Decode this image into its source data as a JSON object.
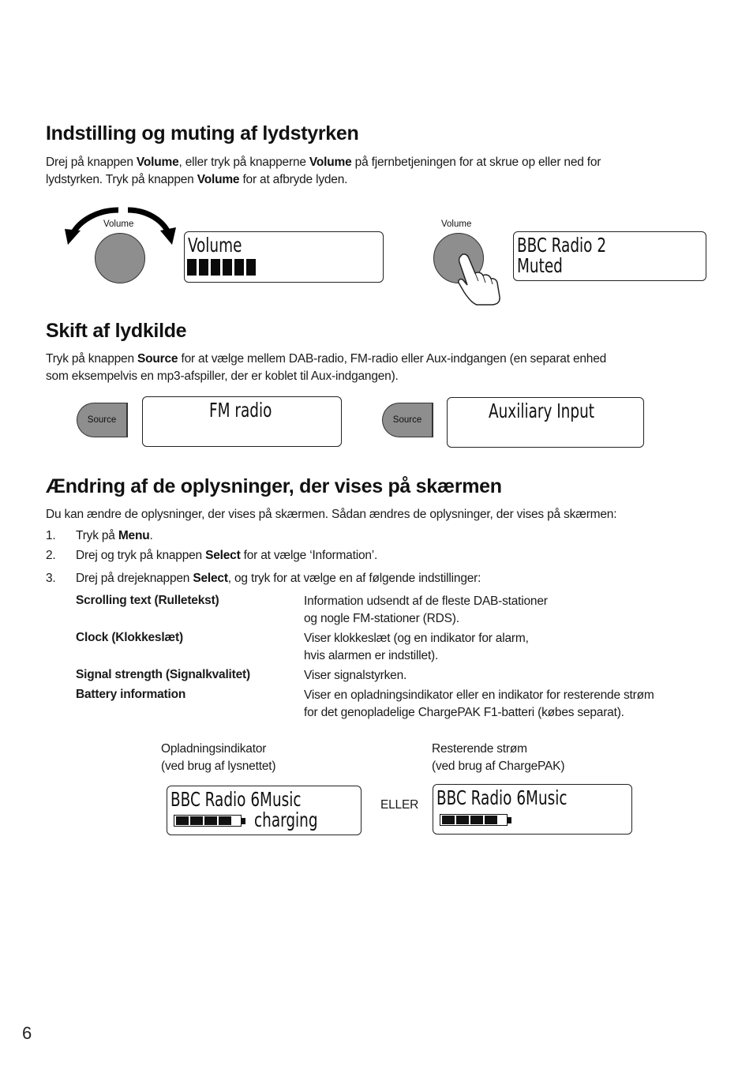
{
  "page_number": "6",
  "section_volume": {
    "heading": "Indstilling og muting af lydstyrken",
    "para_parts": [
      "Drej på knappen ",
      "Volume",
      ", eller tryk på knapperne ",
      "Volume",
      " på fjernbetjeningen for at skrue op eller ned for",
      "lydstyrken. Tryk på knappen ",
      "Volume",
      " for at afbryde lyden."
    ],
    "knob_label_left": "Volume",
    "knob_label_right": "Volume",
    "display_volume": {
      "line1": "Volume",
      "level_bars": 6
    },
    "display_muted": {
      "line1": "BBC Radio 2",
      "line2": "Muted"
    }
  },
  "section_source": {
    "heading": "Skift af lydkilde",
    "para_parts": [
      "Tryk på knappen ",
      "Source",
      " for at vælge mellem DAB-radio, FM-radio eller Aux-indgangen (en separat enhed",
      "som eksempelvis en mp3-afspiller, der er koblet til Aux-indgangen)."
    ],
    "button_label": "Source",
    "display_fm": "FM radio",
    "display_aux": "Auxiliary Input"
  },
  "section_display": {
    "heading": "Ændring af de oplysninger, der vises på skærmen",
    "intro": "Du kan ændre de oplysninger, der vises på skærmen. Sådan ændres de oplysninger, der vises på skærmen:",
    "steps": [
      {
        "num": "1.",
        "pre": "Tryk på ",
        "bold": "Menu",
        "post": "."
      },
      {
        "num": "2.",
        "pre": "Drej og tryk på knappen ",
        "bold": "Select",
        "post": " for at vælge ‘Information’."
      },
      {
        "num": "3.",
        "pre": "Drej på drejeknappen ",
        "bold": "Select",
        "post": ", og tryk for at vælge en af følgende indstillinger:"
      }
    ],
    "options": [
      {
        "name": "Scrolling text (Rulletekst)",
        "desc1": "Information udsendt af de fleste DAB-stationer",
        "desc2": "og nogle FM-stationer (RDS)."
      },
      {
        "name": "Clock (Klokkeslæt)",
        "desc1": "Viser klokkeslæt (og en indikator for alarm,",
        "desc2": "hvis alarmen er indstillet)."
      },
      {
        "name": "Signal strength (Signalkvalitet)",
        "desc1": "Viser signalstyrken.",
        "desc2": ""
      },
      {
        "name": "Battery information",
        "desc1": "Viser en opladningsindikator eller en indikator for resterende strøm",
        "desc2": "for det genopladelige ChargePAK F1-batteri (købes separat)."
      }
    ],
    "caption_left_1": "Opladningsindikator",
    "caption_left_2": "(ved brug af lysnettet)",
    "caption_right_1": "Resterende strøm",
    "caption_right_2": "(ved brug af ChargePAK)",
    "or_label": "ELLER",
    "display_charging": {
      "line1": "BBC Radio 6Music",
      "line2": "charging",
      "battery_segments": 4
    },
    "display_remaining": {
      "line1": "BBC Radio 6Music",
      "battery_segments": 4
    }
  }
}
